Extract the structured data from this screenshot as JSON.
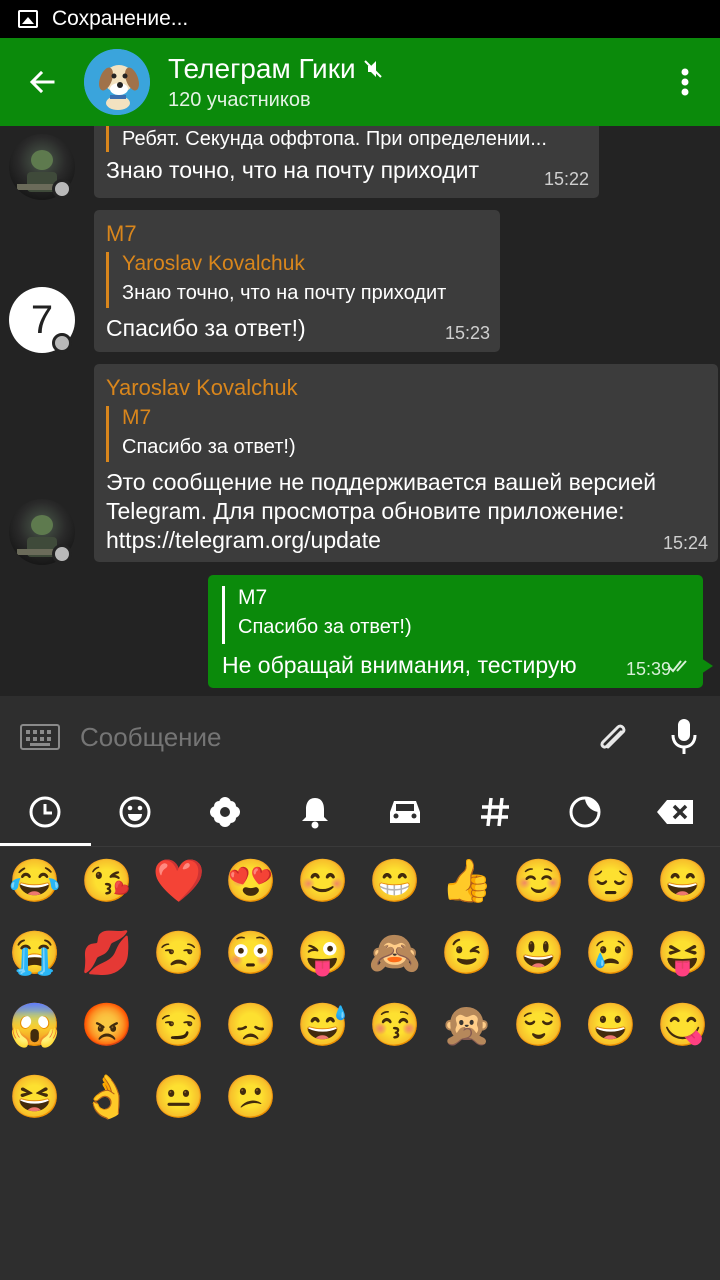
{
  "status_bar": {
    "text": "Сохранение..."
  },
  "header": {
    "title": "Телеграм Гики",
    "subtitle": "120 участников"
  },
  "messages": [
    {
      "quote_text": "Ребят. Секунда оффтопа. При определении...",
      "text": "Знаю точно, что на почту приходит",
      "time": "15:22"
    },
    {
      "author": "M7",
      "quote_author": "Yaroslav Kovalchuk",
      "quote_text": "Знаю точно, что на почту приходит",
      "text": "Спасибо за ответ!)",
      "time": "15:23",
      "avatar_letter": "7"
    },
    {
      "author": "Yaroslav Kovalchuk",
      "quote_author": "M7",
      "quote_text": "Спасибо за ответ!)",
      "text_lines": [
        "Это сообщение не поддерживается вашей версией",
        "Telegram. Для просмотра обновите приложение:",
        "https://telegram.org/update"
      ],
      "time": "15:24"
    },
    {
      "quote_author": "M7",
      "quote_text": "Спасибо за ответ!)",
      "text": "Не обращай внимания, тестирую",
      "time": "15:39",
      "outgoing": true
    }
  ],
  "composer": {
    "placeholder": "Сообщение"
  },
  "emoji_tabs": [
    "recent-icon",
    "smiley-icon",
    "flower-icon",
    "bell-icon",
    "car-icon",
    "hashtag-icon",
    "moon-icon",
    "backspace-icon"
  ],
  "emojis": [
    "😂",
    "😘",
    "❤️",
    "😍",
    "😊",
    "😁",
    "👍",
    "☺️",
    "😔",
    "😄",
    "😭",
    "💋",
    "😒",
    "😳",
    "😜",
    "🙈",
    "😉",
    "😃",
    "😢",
    "😝",
    "😱",
    "😡",
    "😏",
    "😞",
    "😅",
    "😚",
    "🙊",
    "😌",
    "😀",
    "😋",
    "😆",
    "👌",
    "😐",
    "😕"
  ],
  "colors": {
    "accent": "#0b8a0b",
    "author": "#d9861c",
    "bubble": "#3c3c3c",
    "background": "#232323"
  }
}
